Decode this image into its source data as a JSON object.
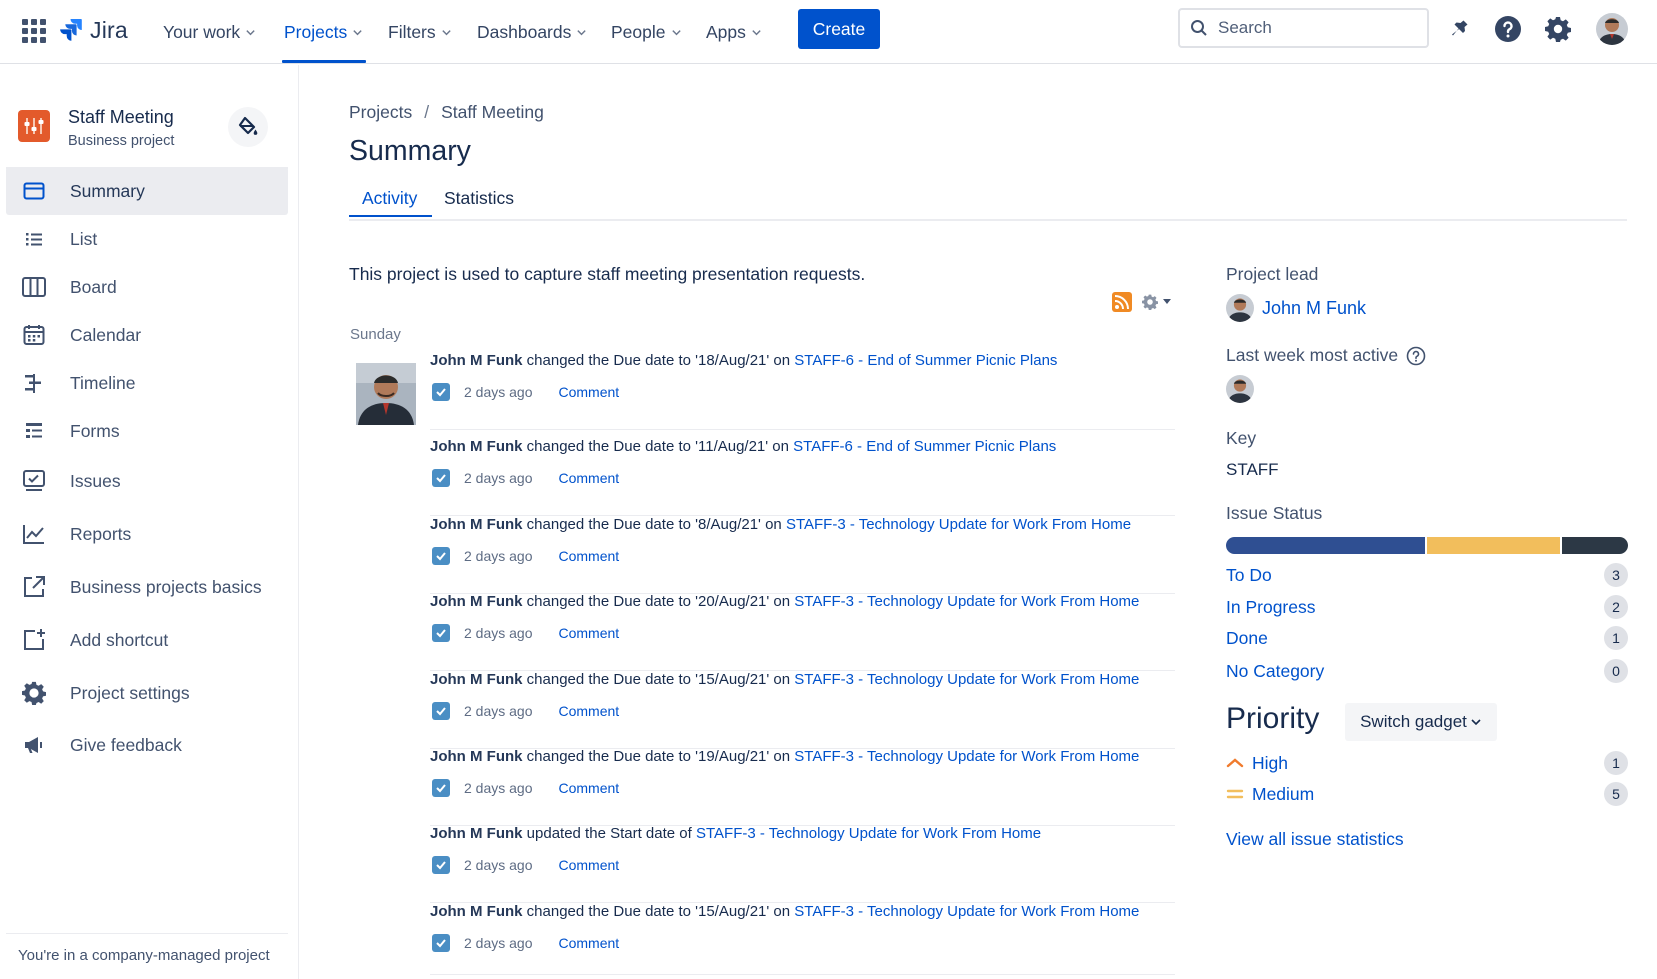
{
  "nav": {
    "logo_text": "Jira",
    "items": [
      {
        "label": "Your work"
      },
      {
        "label": "Projects"
      },
      {
        "label": "Filters"
      },
      {
        "label": "Dashboards"
      },
      {
        "label": "People"
      },
      {
        "label": "Apps"
      }
    ],
    "active_item": "Projects",
    "create_label": "Create",
    "search_placeholder": "Search"
  },
  "sidebar": {
    "project_name": "Staff Meeting",
    "project_type": "Business project",
    "items": [
      {
        "label": "Summary",
        "icon": "summary-icon",
        "selected": true
      },
      {
        "label": "List",
        "icon": "list-icon"
      },
      {
        "label": "Board",
        "icon": "board-icon"
      },
      {
        "label": "Calendar",
        "icon": "calendar-icon"
      },
      {
        "label": "Timeline",
        "icon": "timeline-icon"
      },
      {
        "label": "Forms",
        "icon": "forms-icon"
      },
      {
        "label": "Issues",
        "icon": "issues-icon"
      },
      {
        "label": "Reports",
        "icon": "reports-icon"
      },
      {
        "label": "Business projects basics",
        "icon": "external-link-icon"
      },
      {
        "label": "Add shortcut",
        "icon": "add-shortcut-icon"
      },
      {
        "label": "Project settings",
        "icon": "gear-icon"
      },
      {
        "label": "Give feedback",
        "icon": "megaphone-icon"
      }
    ],
    "footer": "You're in a company-managed project"
  },
  "main": {
    "breadcrumb": [
      "Projects",
      "Staff Meeting"
    ],
    "breadcrumb_sep": "/",
    "title": "Summary",
    "tabs": [
      {
        "label": "Activity",
        "active": true
      },
      {
        "label": "Statistics"
      }
    ],
    "description": "This project is used to capture staff meeting presentation requests.",
    "day_label": "Sunday",
    "activities": [
      {
        "author": "John M Funk",
        "action": " changed the Due date to '18/Aug/21' on ",
        "issue": "STAFF-6 - End of Summer Picnic Plans",
        "time": "2 days ago",
        "comment": "Comment"
      },
      {
        "author": "John M Funk",
        "action": " changed the Due date to '11/Aug/21' on ",
        "issue": "STAFF-6 - End of Summer Picnic Plans",
        "time": "2 days ago",
        "comment": "Comment"
      },
      {
        "author": "John M Funk",
        "action": " changed the Due date to '8/Aug/21' on ",
        "issue": "STAFF-3 - Technology Update for Work From Home",
        "time": "2 days ago",
        "comment": "Comment"
      },
      {
        "author": "John M Funk",
        "action": " changed the Due date to '20/Aug/21' on ",
        "issue": "STAFF-3 - Technology Update for Work From Home",
        "time": "2 days ago",
        "comment": "Comment"
      },
      {
        "author": "John M Funk",
        "action": " changed the Due date to '15/Aug/21' on ",
        "issue": "STAFF-3 - Technology Update for Work From Home",
        "time": "2 days ago",
        "comment": "Comment"
      },
      {
        "author": "John M Funk",
        "action": " changed the Due date to '19/Aug/21' on ",
        "issue": "STAFF-3 - Technology Update for Work From Home",
        "time": "2 days ago",
        "comment": "Comment"
      },
      {
        "author": "John M Funk",
        "action": " updated the Start date of ",
        "issue": "STAFF-3 - Technology Update for Work From Home",
        "time": "2 days ago",
        "comment": "Comment"
      },
      {
        "author": "John M Funk",
        "action": " changed the Due date to '15/Aug/21' on ",
        "issue": "STAFF-3 - Technology Update for Work From Home",
        "time": "2 days ago",
        "comment": "Comment"
      }
    ]
  },
  "right_panel": {
    "project_lead_label": "Project lead",
    "project_lead": "John M Funk",
    "last_week_label": "Last week most active",
    "key_label": "Key",
    "key_value": "STAFF",
    "issue_status_label": "Issue Status",
    "statuses": [
      {
        "label": "To Do",
        "count": "3",
        "color": "#2f4f92"
      },
      {
        "label": "In Progress",
        "count": "2",
        "color": "#f2be5c"
      },
      {
        "label": "Done",
        "count": "1",
        "color": "#2c3845"
      },
      {
        "label": "No Category",
        "count": "0",
        "color": "#dfe1e6"
      }
    ],
    "priority_title": "Priority",
    "switch_gadget_label": "Switch gadget",
    "priorities": [
      {
        "label": "High",
        "count": "1",
        "icon": "priority-high-icon",
        "color": "#f07b2d"
      },
      {
        "label": "Medium",
        "count": "5",
        "icon": "priority-medium-icon",
        "color": "#f2be5c"
      }
    ],
    "view_all_label": "View all issue statistics"
  },
  "colors": {
    "brand": "#0052cc",
    "text": "#172b4d",
    "project_avatar": "#e35a2b"
  }
}
